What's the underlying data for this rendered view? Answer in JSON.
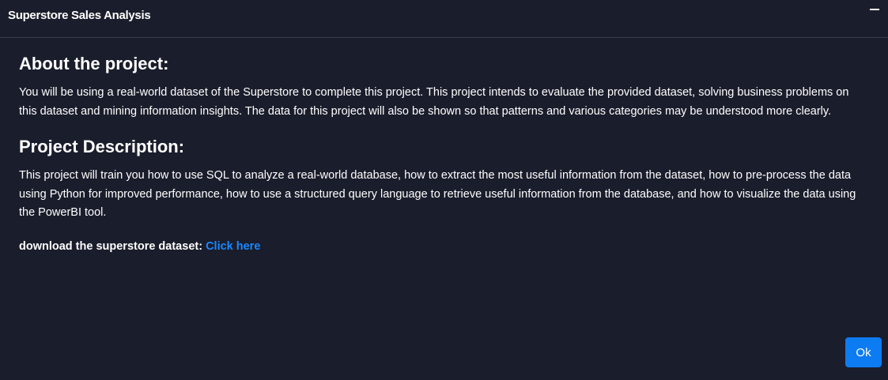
{
  "modal": {
    "title": "Superstore Sales Analysis"
  },
  "about": {
    "heading": "About the project:",
    "text": "You will be using a real-world dataset of the Superstore to complete this project. This project intends to evaluate the provided dataset, solving business problems on this dataset and mining information insights. The data for this project will also be shown so that patterns and various categories may be understood more clearly."
  },
  "description": {
    "heading": "Project Description:",
    "text": "This project will train you how to use SQL to analyze a real-world database, how to extract the most useful information from the dataset, how to pre-process the data using Python for improved performance, how to use a structured query language to retrieve useful information from the database, and how to visualize the data using the PowerBI tool."
  },
  "download": {
    "label": "download the superstore dataset: ",
    "link_text": "Click here"
  },
  "footer": {
    "ok_label": "Ok"
  },
  "colors": {
    "background": "#1a1d2b",
    "link": "#1a88ff",
    "button": "#0d7cf2"
  }
}
